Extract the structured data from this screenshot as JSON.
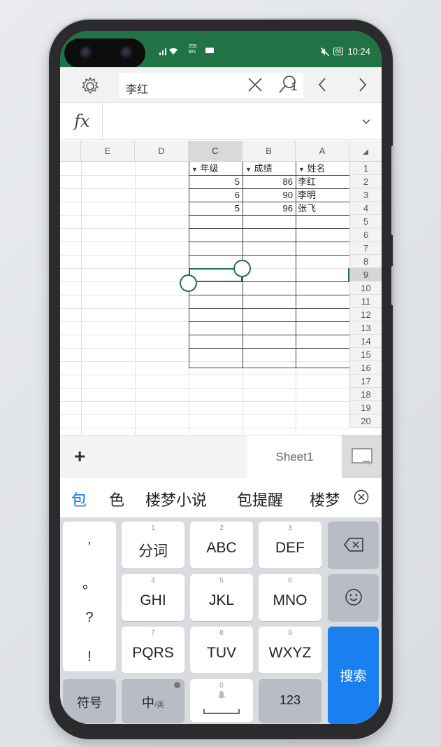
{
  "status_bar": {
    "signal_text": "⁴⁶ᵢₗₗ",
    "speed_value": "255",
    "speed_unit": "B/s",
    "battery": "66",
    "time": "10:24"
  },
  "toolbar": {
    "search_value": "李红",
    "match_count": "1"
  },
  "formula_bar": {
    "fx_label": "fx",
    "value": ""
  },
  "grid": {
    "columns": [
      "E",
      "D",
      "C",
      "B",
      "A"
    ],
    "selected_column": "C",
    "rows": [
      "1",
      "2",
      "3",
      "4",
      "5",
      "6",
      "7",
      "8",
      "9",
      "10",
      "11",
      "12",
      "13",
      "14",
      "15",
      "16",
      "17",
      "18",
      "19",
      "20"
    ],
    "selected_row": "9",
    "headers": {
      "grade": "年级",
      "score": "成绩",
      "name": "姓名"
    },
    "records": [
      {
        "grade": "5",
        "score": "86",
        "name": "李红"
      },
      {
        "grade": "6",
        "score": "90",
        "name": "李明"
      },
      {
        "grade": "5",
        "score": "96",
        "name": "张飞"
      }
    ]
  },
  "sheet_bar": {
    "add_label": "+",
    "sheet_name": "Sheet1"
  },
  "candidates": [
    "包",
    "色",
    "楼梦小说",
    "包提醒",
    "楼梦"
  ],
  "keyboard": {
    "punctuation": [
      ",",
      "。",
      "?",
      "!"
    ],
    "keys": [
      {
        "num": "1",
        "label": "分词"
      },
      {
        "num": "2",
        "label": "ABC"
      },
      {
        "num": "3",
        "label": "DEF"
      },
      {
        "num": "4",
        "label": "GHI"
      },
      {
        "num": "5",
        "label": "JKL"
      },
      {
        "num": "6",
        "label": "MNO"
      },
      {
        "num": "7",
        "label": "PQRS"
      },
      {
        "num": "8",
        "label": "TUV"
      },
      {
        "num": "9",
        "label": "WXYZ"
      }
    ],
    "symbols_label": "符号",
    "lang_label": "中",
    "lang_sub": "/英",
    "space_num": "0",
    "numbers_label": "123",
    "search_label": "搜索"
  },
  "colors": {
    "accent": "#217346",
    "search_key": "#1a80f0",
    "candidate_highlight": "#1a73e8"
  }
}
